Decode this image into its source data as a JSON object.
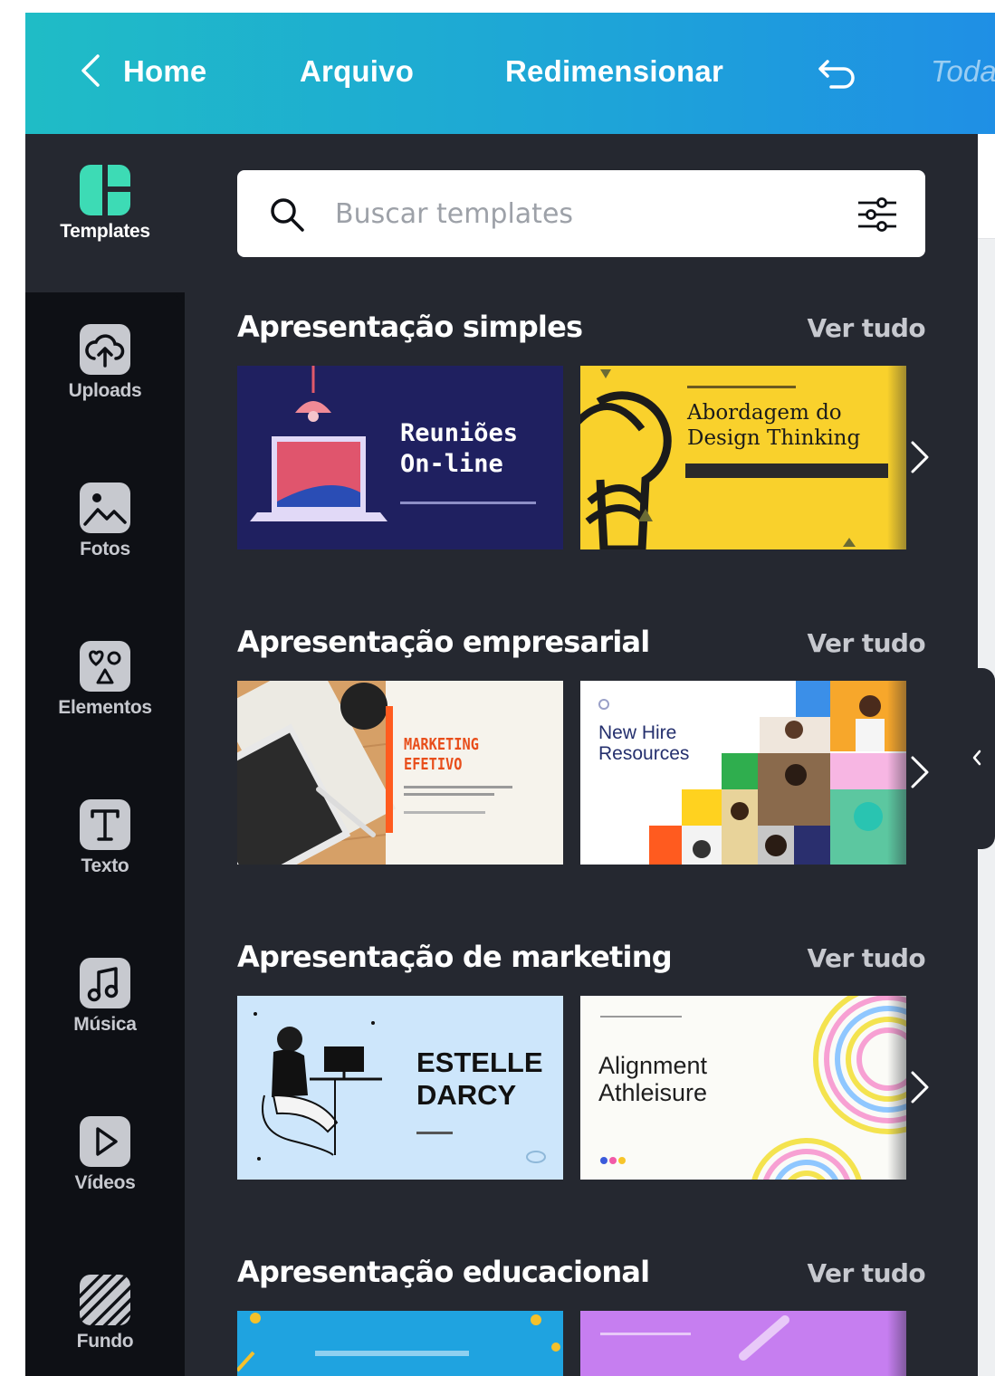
{
  "header": {
    "home_label": "Home",
    "file_label": "Arquivo",
    "resize_label": "Redimensionar",
    "title_partial": "Toda"
  },
  "sidebar": {
    "items": [
      {
        "label": "Templates",
        "icon": "templates-icon",
        "active": true
      },
      {
        "label": "Uploads",
        "icon": "upload-cloud-icon"
      },
      {
        "label": "Fotos",
        "icon": "photo-icon"
      },
      {
        "label": "Elementos",
        "icon": "shapes-icon"
      },
      {
        "label": "Texto",
        "icon": "text-icon"
      },
      {
        "label": "Música",
        "icon": "music-icon"
      },
      {
        "label": "Vídeos",
        "icon": "video-icon"
      },
      {
        "label": "Fundo",
        "icon": "background-icon"
      }
    ]
  },
  "search": {
    "placeholder": "Buscar templates",
    "value": ""
  },
  "sections": [
    {
      "title": "Apresentação simples",
      "see_all": "Ver tudo",
      "templates": [
        {
          "title_line1": "Reuniões",
          "title_line2": "On-line"
        },
        {
          "title_line1": "Abordagem do",
          "title_line2": "Design Thinking"
        }
      ]
    },
    {
      "title": "Apresentação empresarial",
      "see_all": "Ver tudo",
      "templates": [
        {
          "title_line1": "MARKETING",
          "title_line2": "EFETIVO"
        },
        {
          "title_line1": "New Hire",
          "title_line2": "Resources"
        }
      ]
    },
    {
      "title": "Apresentação de marketing",
      "see_all": "Ver tudo",
      "templates": [
        {
          "title_line1": "ESTELLE",
          "title_line2": "DARCY"
        },
        {
          "title_line1": "Alignment",
          "title_line2": "Athleisure"
        }
      ]
    },
    {
      "title": "Apresentação educacional",
      "see_all": "Ver tudo",
      "templates": [
        {
          "title_line1": "",
          "title_line2": ""
        },
        {
          "title_line1": "",
          "title_line2": ""
        }
      ]
    }
  ],
  "colors": {
    "header_start": "#1fbcc6",
    "header_end": "#1f8fe5",
    "sidebar_bg": "#0e1015",
    "panel_bg": "#252830",
    "templates_icon": "#3ddbb5"
  }
}
